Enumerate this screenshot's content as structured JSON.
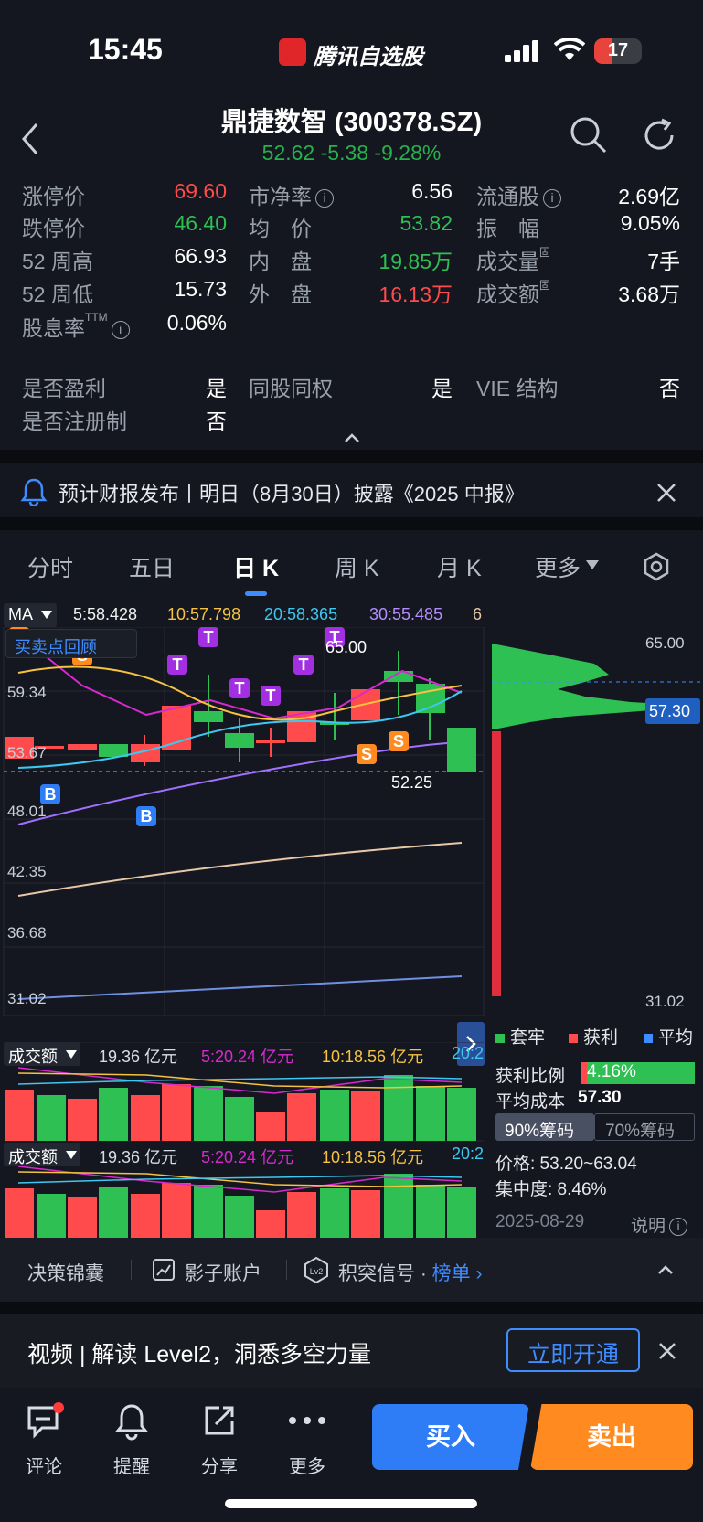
{
  "status": {
    "time": "15:45",
    "app_name": "腾讯自选股",
    "battery": "17"
  },
  "header": {
    "title": "鼎捷数智 (300378.SZ)",
    "price_line": "52.62  -5.38  -9.28%"
  },
  "stats": {
    "limit_up_label": "涨停价",
    "limit_up": "69.60",
    "limit_down_label": "跌停价",
    "limit_down": "46.40",
    "high52_label": "52 周高",
    "high52": "66.93",
    "low52_label": "52 周低",
    "low52": "15.73",
    "dividend_label": "股息率",
    "dividend_sup": "TTM",
    "dividend": "0.06%",
    "pb_label": "市净率",
    "pb": "6.56",
    "avg_label": "均　价",
    "avg": "53.82",
    "inner_label": "内　盘",
    "inner": "19.85万",
    "outer_label": "外　盘",
    "outer": "16.13万",
    "float_label": "流通股",
    "float": "2.69亿",
    "amplitude_label": "振　幅",
    "amplitude": "9.05%",
    "volume_label": "成交量",
    "volume_sup": "固",
    "volume": "7手",
    "turnover_label": "成交额",
    "turnover_sup": "固",
    "turnover": "3.68万",
    "profit_label": "是否盈利",
    "profit": "是",
    "same_right_label": "同股同权",
    "same_right": "是",
    "vie_label": "VIE 结构",
    "vie": "否",
    "registered_label": "是否注册制",
    "registered": "否"
  },
  "notice": {
    "text": "预计财报发布丨明日（8月30日）披露《2025 中报》"
  },
  "tabs": [
    "分时",
    "五日",
    "日 K",
    "周 K",
    "月 K",
    "更多"
  ],
  "ma": {
    "label": "MA",
    "ma5": "5:58.428",
    "ma10": "10:57.798",
    "ma20": "20:58.365",
    "ma30": "30:55.485",
    "ma_more": "6"
  },
  "review_btn": "买卖点回顾",
  "price_axis": [
    "59.34",
    "53.67",
    "48.01",
    "42.35",
    "36.68",
    "31.02"
  ],
  "chart_notes": {
    "high": "65.00",
    "low": "52.25",
    "ruler_top": "65.00",
    "ruler_bottom": "31.02",
    "current": "57.30"
  },
  "markers": {
    "s": "S",
    "t": "T",
    "b": "B"
  },
  "chip": {
    "legend_trapped": "套牢",
    "legend_profit": "获利",
    "legend_avg": "平均",
    "profit_ratio_label": "获利比例",
    "profit_ratio": "4.16%",
    "avg_cost_label": "平均成本",
    "avg_cost": "57.30",
    "tab90": "90%筹码",
    "tab70": "70%筹码",
    "price_range": "价格: 53.20~63.04",
    "concentration": "集中度: 8.46%",
    "date": "2025-08-29",
    "explain": "说明"
  },
  "volume_panels": [
    {
      "label": "成交额",
      "v": "19.36 亿元",
      "v5": "5:20.24 亿元",
      "v10": "10:18.56 亿元",
      "v20": "20:2"
    },
    {
      "label": "成交额",
      "v": "19.36 亿元",
      "v5": "5:20.24 亿元",
      "v10": "10:18.56 亿元",
      "v20": "20:2"
    }
  ],
  "toolbar": {
    "item1": "决策锦囊",
    "item2": "影子账户",
    "item3": "积突信号 · ",
    "item3_link": "榜单",
    "lv2": "Lv2"
  },
  "promo": {
    "text": "视频 | 解读 Level2，洞悉多空力量",
    "button": "立即开通"
  },
  "bottom_nav": {
    "comment": "评论",
    "alert": "提醒",
    "share": "分享",
    "more": "更多",
    "buy": "买入",
    "sell": "卖出"
  },
  "colors": {
    "up": "#ff4b4b",
    "down": "#2ec052",
    "accent": "#3f8cff",
    "sell": "#ff8a1f"
  }
}
